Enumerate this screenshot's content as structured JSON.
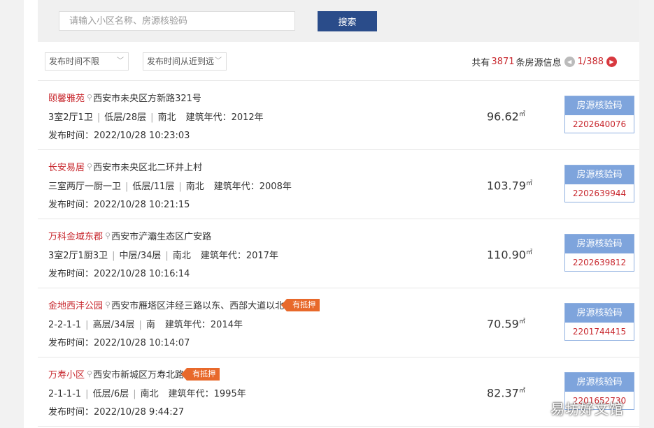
{
  "search": {
    "placeholder": "请输入小区名称、房源核验码",
    "button_label": "搜索"
  },
  "filters": {
    "time_filter": "发布时间不限",
    "sort_order": "发布时间从近到远"
  },
  "summary": {
    "prefix": "共有",
    "count": "3871",
    "suffix": "条房源信息",
    "page_indicator": "1/388"
  },
  "verify_label": "房源核验码",
  "listings": [
    {
      "name": "颐馨雅苑",
      "address": "西安市未央区方新路321号",
      "tag": "",
      "layout": "3室2厅1卫",
      "floor": "低层/28层",
      "orientation": "南北",
      "year": "建筑年代：2012年",
      "time": "发布时间：2022/10/28 10:23:03",
      "area": "96.62",
      "area_unit": "㎡",
      "code": "2202640076"
    },
    {
      "name": "长安易居",
      "address": "西安市未央区北二环井上村",
      "tag": "",
      "layout": "三室两厅一厨一卫",
      "floor": "低层/11层",
      "orientation": "南北",
      "year": "建筑年代：2008年",
      "time": "发布时间：2022/10/28 10:21:15",
      "area": "103.79",
      "area_unit": "㎡",
      "code": "2202639944"
    },
    {
      "name": "万科金域东郡",
      "address": "西安市浐灞生态区广安路",
      "tag": "",
      "layout": "3室2厅1厨3卫",
      "floor": "中层/34层",
      "orientation": "南北",
      "year": "建筑年代：2017年",
      "time": "发布时间：2022/10/28 10:16:14",
      "area": "110.90",
      "area_unit": "㎡",
      "code": "2202639812"
    },
    {
      "name": "金地西沣公园",
      "address": "西安市雁塔区沣经三路以东、西部大道以北",
      "tag": "有抵押",
      "layout": "2-2-1-1",
      "floor": "高层/34层",
      "orientation": "南",
      "year": "建筑年代：2014年",
      "time": "发布时间：2022/10/28 10:14:07",
      "area": "70.59",
      "area_unit": "㎡",
      "code": "2201744415"
    },
    {
      "name": "万寿小区",
      "address": "西安市新城区万寿北路",
      "tag": "有抵押",
      "layout": "2-1-1-1",
      "floor": "低层/6层",
      "orientation": "南北",
      "year": "建筑年代：1995年",
      "time": "发布时间：2022/10/28 9:44:27",
      "area": "82.37",
      "area_unit": "㎡",
      "code": "2201652730"
    }
  ],
  "watermark": "易坊好文馆"
}
